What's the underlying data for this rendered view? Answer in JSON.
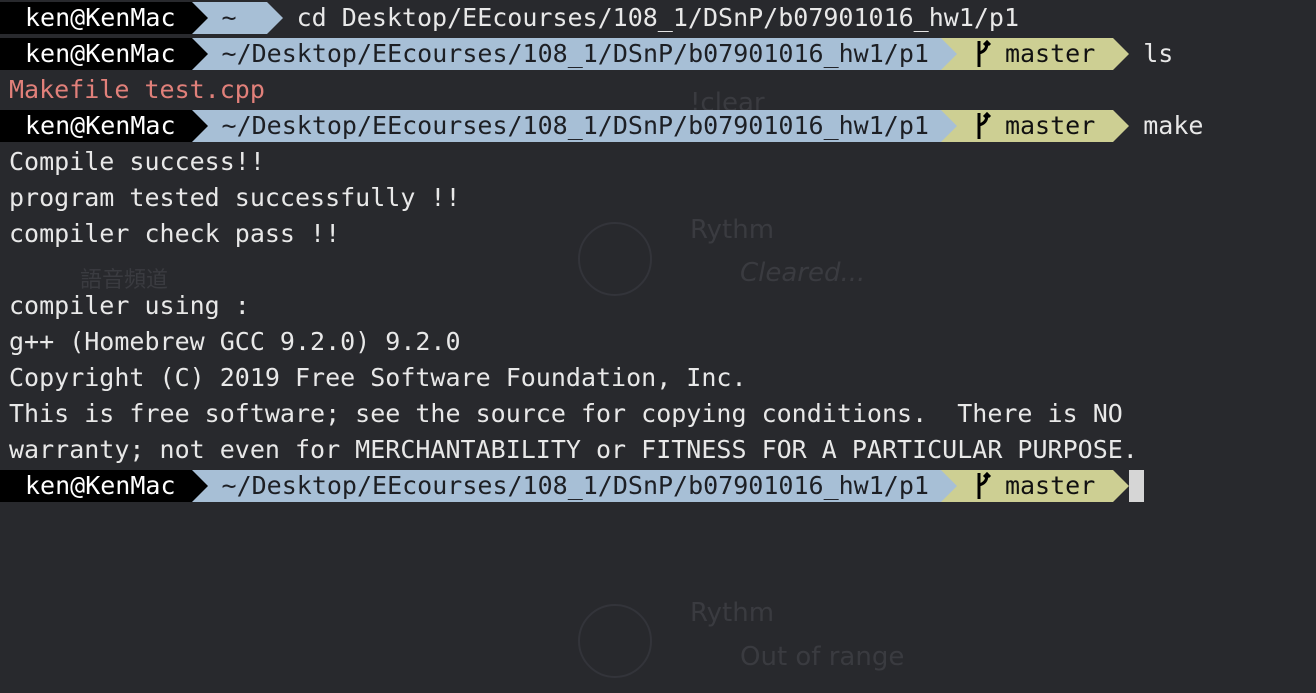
{
  "colors": {
    "background": "#28292d",
    "user_segment": "#000000",
    "path_segment": "#a7bfd6",
    "git_segment": "#cdcf93",
    "ls_file_color": "#e1807a",
    "text": "#e8e8e8"
  },
  "ghost_text": {
    "clear": "!clear",
    "rythm1": "Rythm",
    "cleared": "Cleared...",
    "rythm2": "Rythm",
    "out_of_range": "Out of range",
    "channel": "語音頻道"
  },
  "terminal": {
    "user": "ken@KenMac",
    "first_prompt_path": "~",
    "first_command": "cd Desktop/EEcourses/108_1/DSnP/b07901016_hw1/p1",
    "path": "~/Desktop/EEcourses/108_1/DSnP/b07901016_hw1/p1",
    "branch": "master",
    "branch_icon": "git-branch-icon",
    "second_command": "ls",
    "ls_output": "Makefile test.cpp",
    "third_command": "make",
    "make_output": [
      "Compile success!!",
      "program tested successfully !!",
      "compiler check pass !!",
      "",
      "compiler using :",
      "g++ (Homebrew GCC 9.2.0) 9.2.0",
      "Copyright (C) 2019 Free Software Foundation, Inc.",
      "This is free software; see the source for copying conditions.  There is NO",
      "warranty; not even for MERCHANTABILITY or FITNESS FOR A PARTICULAR PURPOSE."
    ]
  }
}
